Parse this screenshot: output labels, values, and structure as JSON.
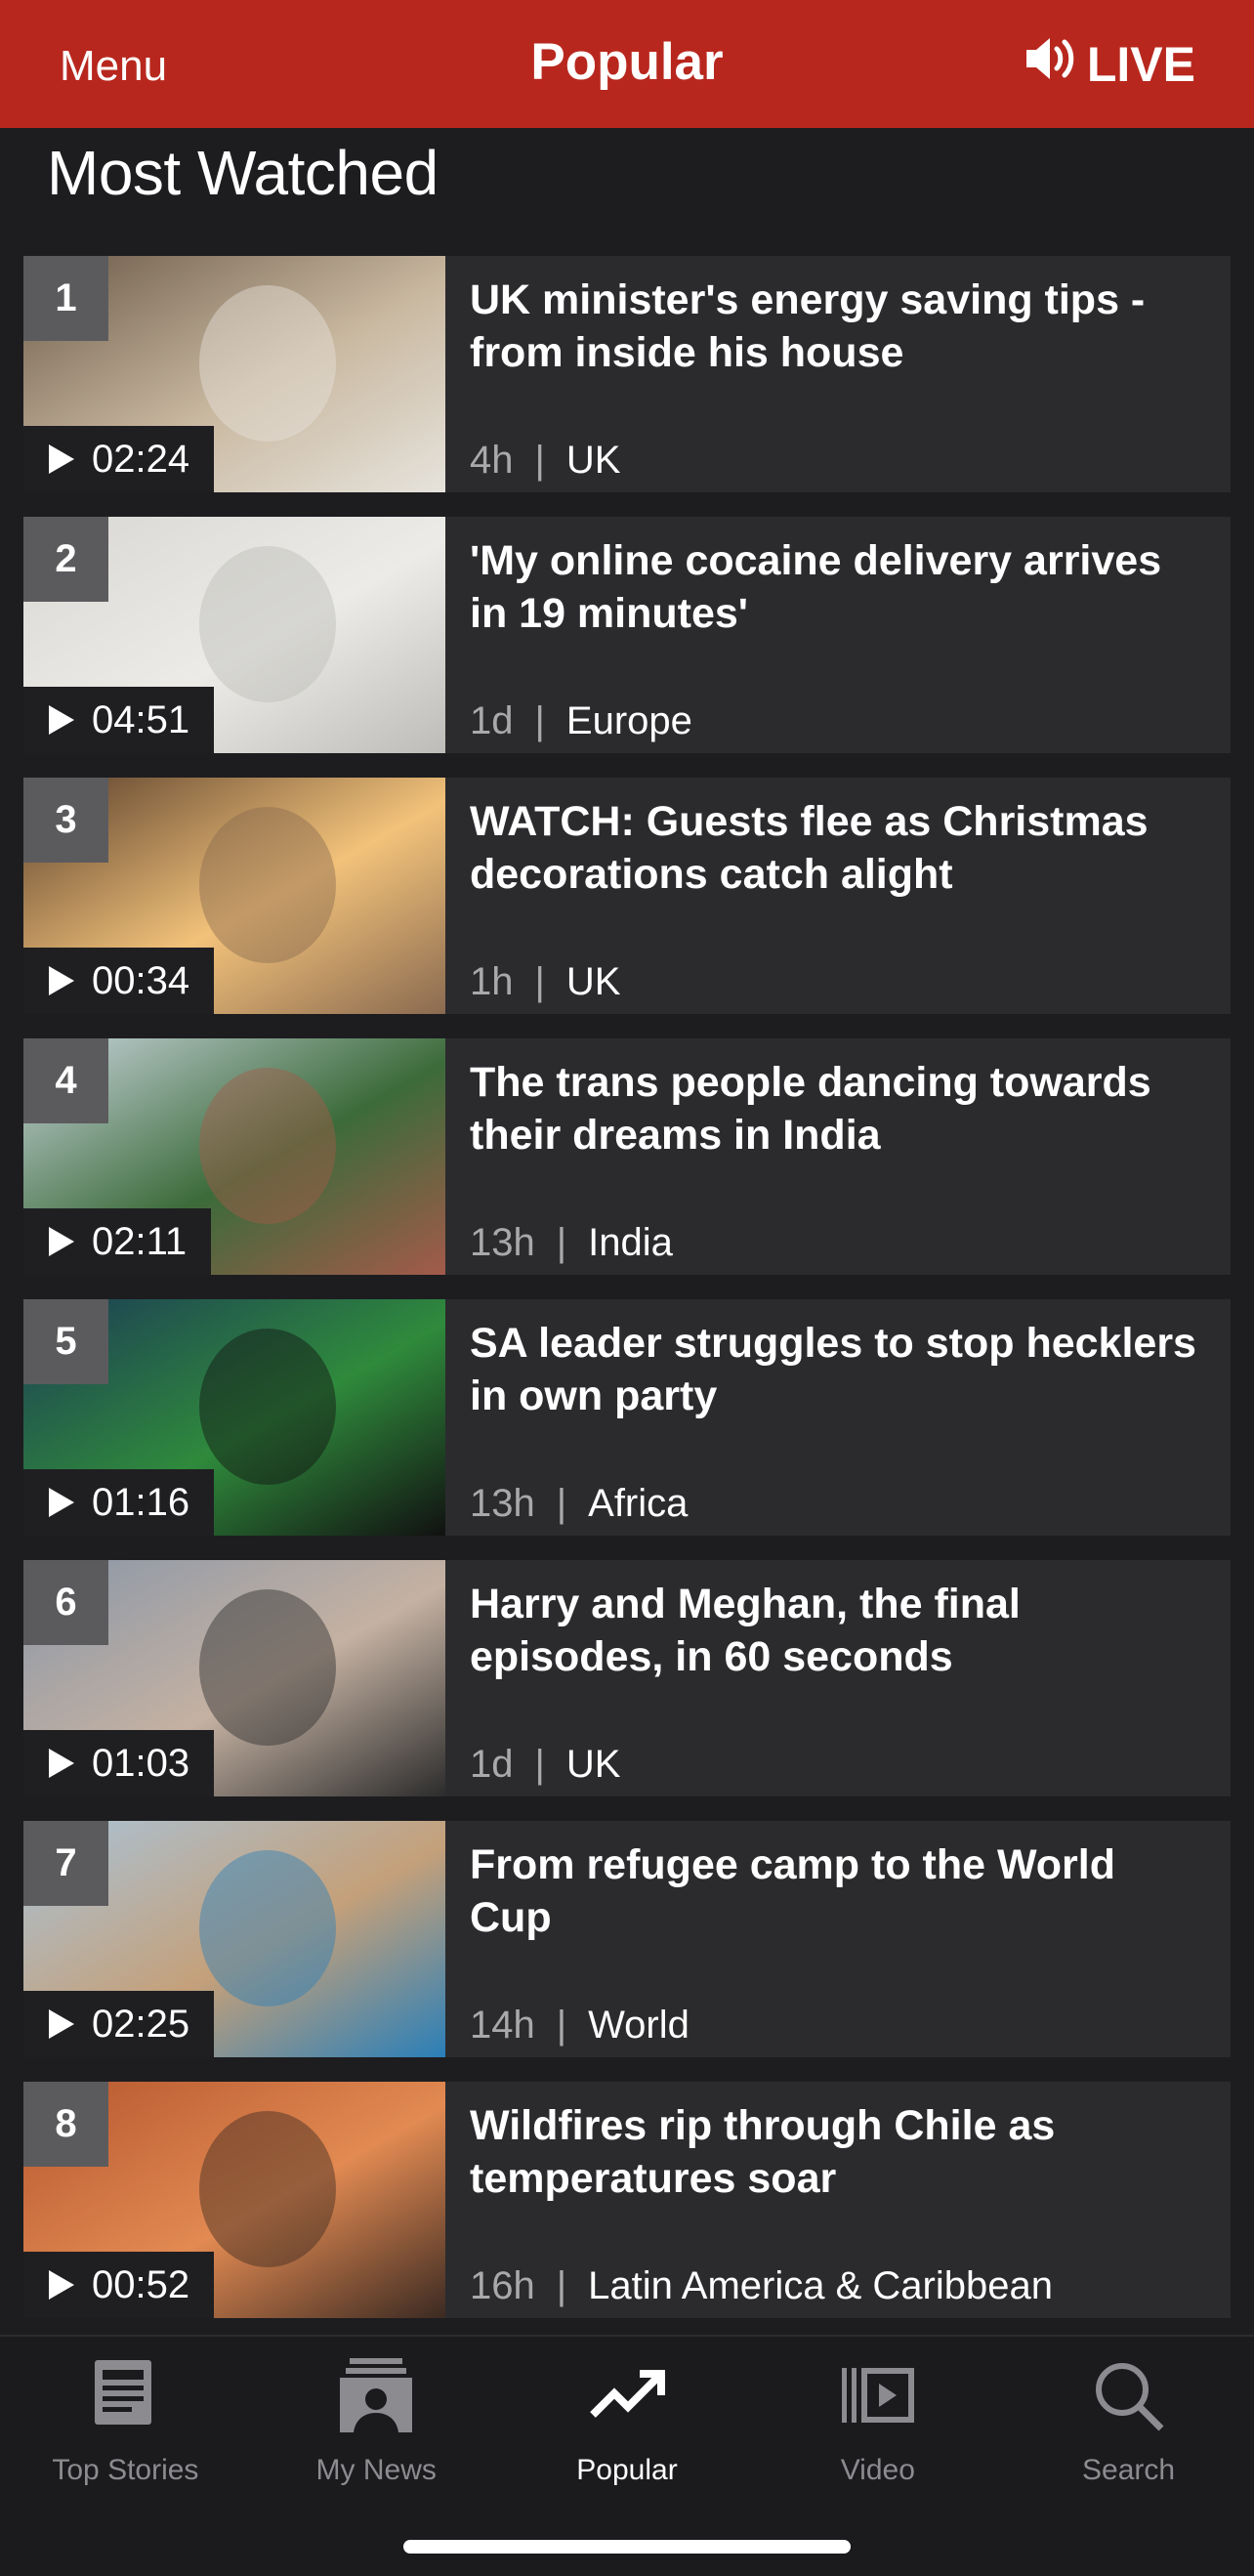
{
  "header": {
    "menu_label": "Menu",
    "title": "Popular",
    "live_label": "LIVE",
    "brand_color": "#b8271d"
  },
  "section": {
    "title": "Most Watched"
  },
  "items": [
    {
      "rank": "1",
      "duration": "02:24",
      "headline": "UK minister's energy saving tips - from inside his house",
      "time": "4h",
      "category": "UK",
      "thumb_colors": [
        "#6b5a48",
        "#c9b8a0",
        "#e6e3dc"
      ]
    },
    {
      "rank": "2",
      "duration": "04:51",
      "headline": "'My online cocaine delivery arrives in 19 minutes'",
      "time": "1d",
      "category": "Europe",
      "thumb_colors": [
        "#d8d7d3",
        "#ecebe7",
        "#bdbcb8"
      ]
    },
    {
      "rank": "3",
      "duration": "00:34",
      "headline": "WATCH: Guests flee as Christmas decorations catch alight",
      "time": "1h",
      "category": "UK",
      "thumb_colors": [
        "#5a3f2c",
        "#f2c27a",
        "#8a6a50"
      ]
    },
    {
      "rank": "4",
      "duration": "02:11",
      "headline": "The trans people dancing towards their dreams in India",
      "time": "13h",
      "category": "India",
      "thumb_colors": [
        "#c8d4dc",
        "#3c6b3a",
        "#a35a4a"
      ]
    },
    {
      "rank": "5",
      "duration": "01:16",
      "headline": "SA leader struggles to stop hecklers in own party",
      "time": "13h",
      "category": "Africa",
      "thumb_colors": [
        "#1c3d56",
        "#2f8a3c",
        "#111111"
      ]
    },
    {
      "rank": "6",
      "duration": "01:03",
      "headline": "Harry and Meghan, the final episodes, in 60 seconds",
      "time": "1d",
      "category": "UK",
      "thumb_colors": [
        "#8a97a8",
        "#c4b1a2",
        "#2c2c2c"
      ]
    },
    {
      "rank": "7",
      "duration": "02:25",
      "headline": "From refugee camp to the World Cup",
      "time": "14h",
      "category": "World",
      "thumb_colors": [
        "#a9c3d8",
        "#c4a07a",
        "#2a7fb8"
      ]
    },
    {
      "rank": "8",
      "duration": "00:52",
      "headline": "Wildfires rip through Chile as temperatures soar",
      "time": "16h",
      "category": "Latin America & Caribbean",
      "thumb_colors": [
        "#b5562e",
        "#e28a52",
        "#3b2a22"
      ]
    }
  ],
  "tabs": [
    {
      "label": "Top Stories",
      "icon": "top-stories-icon",
      "active": false
    },
    {
      "label": "My News",
      "icon": "my-news-icon",
      "active": false
    },
    {
      "label": "Popular",
      "icon": "trending-icon",
      "active": true
    },
    {
      "label": "Video",
      "icon": "video-icon",
      "active": false
    },
    {
      "label": "Search",
      "icon": "search-icon",
      "active": false
    }
  ]
}
